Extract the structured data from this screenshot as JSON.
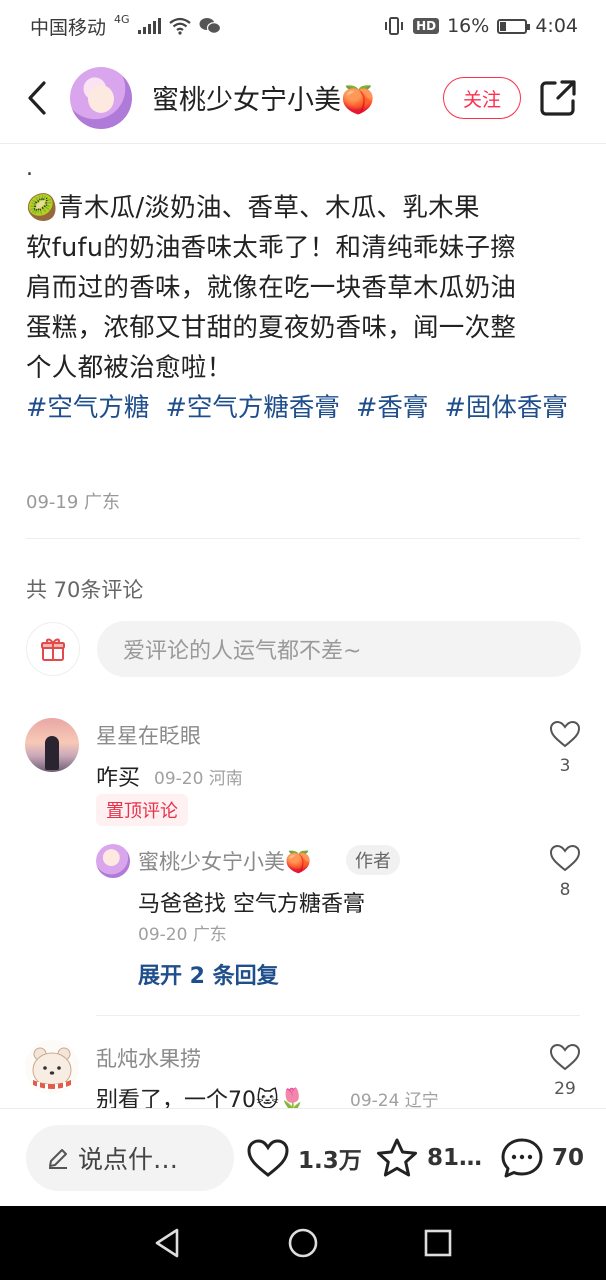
{
  "status_bar": {
    "carrier": "中国移动",
    "network": "4G",
    "battery_pct": "16%",
    "time": "4:04"
  },
  "header": {
    "author_name": "蜜桃少女宁小美🍑",
    "follow_label": "关注"
  },
  "post": {
    "dot_line": ".",
    "body_lines": [
      "🥝青木瓜/淡奶油、香草、木瓜、乳木果",
      "软fufu的奶油香味太乖了！和清纯乖妹子擦",
      "肩而过的香味，就像在吃一块香草木瓜奶油",
      "蛋糕，浓郁又甘甜的夏夜奶香味，闻一次整",
      "个人都被治愈啦！"
    ],
    "tags": [
      "#空气方糖",
      "#空气方糖香膏",
      "#香膏",
      "#固体香膏"
    ],
    "date": "09-19",
    "location": "广东"
  },
  "comments_section": {
    "count_label": "共 70条评论",
    "input_placeholder": "爱评论的人运气都不差~",
    "comments": [
      {
        "name": "星星在眨眼",
        "text": "咋买",
        "date": "09-20",
        "location": "河南",
        "likes": "3",
        "pinned_label": "置顶评论"
      },
      {
        "name": "乱炖水果捞",
        "text": "别看了，一个70🐱🌷",
        "date": "09-24",
        "location": "辽宁",
        "likes": "29"
      }
    ],
    "reply": {
      "name": "蜜桃少女宁小美🍑",
      "badge": "作者",
      "text": "马爸爸找 空气方糖香膏",
      "date": "09-20",
      "location": "广东",
      "likes": "8"
    },
    "expand_label": "展开 2 条回复"
  },
  "bottom_bar": {
    "say_placeholder": "说点什…",
    "likes": "1.3万",
    "collects": "81…",
    "comments": "70"
  },
  "colors": {
    "accent": "#ff2e4d",
    "tag_blue": "#1f4e8c"
  }
}
